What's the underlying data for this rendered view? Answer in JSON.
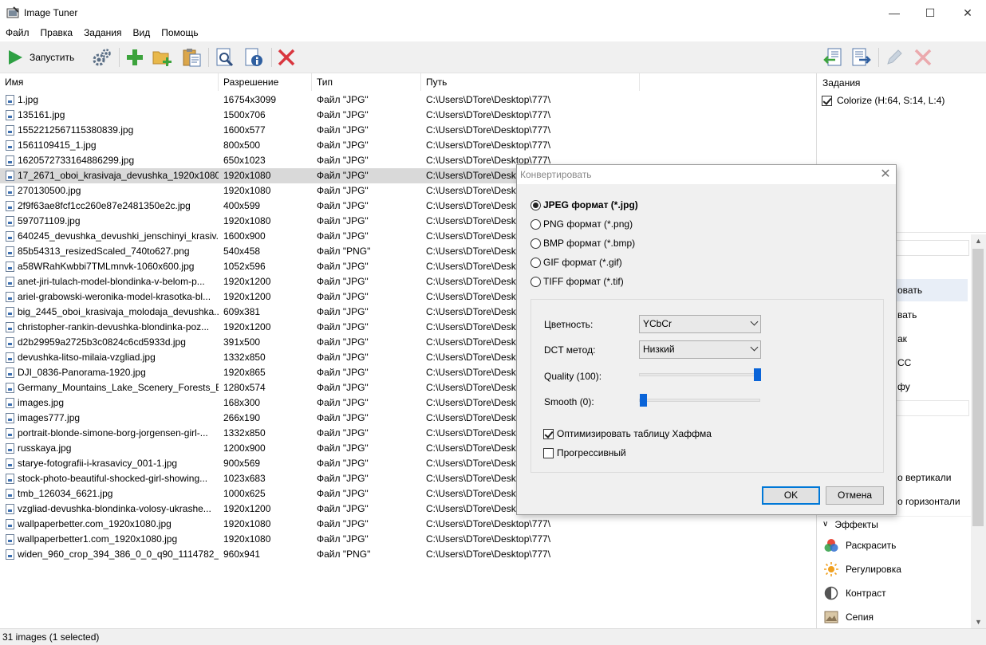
{
  "window": {
    "title": "Image Tuner",
    "minimize": "—",
    "maximize": "☐",
    "close": "✕"
  },
  "menu": [
    "Файл",
    "Правка",
    "Задания",
    "Вид",
    "Помощь"
  ],
  "toolbar": {
    "run_label": "Запустить"
  },
  "columns": {
    "name": "Имя",
    "resolution": "Разрешение",
    "type": "Тип",
    "path": "Путь"
  },
  "files": [
    {
      "name": "1.jpg",
      "res": "16754x3099",
      "type": "Файл \"JPG\"",
      "path": "C:\\Users\\DTore\\Desktop\\777\\"
    },
    {
      "name": "135161.jpg",
      "res": "1500x706",
      "type": "Файл \"JPG\"",
      "path": "C:\\Users\\DTore\\Desktop\\777\\"
    },
    {
      "name": "1552212567115380839.jpg",
      "res": "1600x577",
      "type": "Файл \"JPG\"",
      "path": "C:\\Users\\DTore\\Desktop\\777\\"
    },
    {
      "name": "1561109415_1.jpg",
      "res": "800x500",
      "type": "Файл \"JPG\"",
      "path": "C:\\Users\\DTore\\Desktop\\777\\"
    },
    {
      "name": "1620572733164886299.jpg",
      "res": "650x1023",
      "type": "Файл \"JPG\"",
      "path": "C:\\Users\\DTore\\Desktop\\777\\"
    },
    {
      "name": "17_2671_oboi_krasivaja_devushka_1920x1080....",
      "res": "1920x1080",
      "type": "Файл \"JPG\"",
      "path": "C:\\Users\\DTore\\Deskto"
    },
    {
      "name": "270130500.jpg",
      "res": "1920x1080",
      "type": "Файл \"JPG\"",
      "path": "C:\\Users\\DTore\\Deskto"
    },
    {
      "name": "2f9f63ae8fcf1cc260e87e2481350e2c.jpg",
      "res": "400x599",
      "type": "Файл \"JPG\"",
      "path": "C:\\Users\\DTore\\Deskto"
    },
    {
      "name": "597071109.jpg",
      "res": "1920x1080",
      "type": "Файл \"JPG\"",
      "path": "C:\\Users\\DTore\\Deskto"
    },
    {
      "name": "640245_devushka_devushki_jenschinyi_krasiv...",
      "res": "1600x900",
      "type": "Файл \"JPG\"",
      "path": "C:\\Users\\DTore\\Deskto"
    },
    {
      "name": "85b54313_resizedScaled_740to627.png",
      "res": "540x458",
      "type": "Файл \"PNG\"",
      "path": "C:\\Users\\DTore\\Deskto"
    },
    {
      "name": "a58WRahKwbbi7TMLmnvk-1060x600.jpg",
      "res": "1052x596",
      "type": "Файл \"JPG\"",
      "path": "C:\\Users\\DTore\\Deskto"
    },
    {
      "name": "anet-jiri-tulach-model-blondinka-v-belom-p...",
      "res": "1920x1200",
      "type": "Файл \"JPG\"",
      "path": "C:\\Users\\DTore\\Deskto"
    },
    {
      "name": "ariel-grabowski-weronika-model-krasotka-bl...",
      "res": "1920x1200",
      "type": "Файл \"JPG\"",
      "path": "C:\\Users\\DTore\\Deskto"
    },
    {
      "name": "big_2445_oboi_krasivaja_molodaja_devushka...",
      "res": "609x381",
      "type": "Файл \"JPG\"",
      "path": "C:\\Users\\DTore\\Deskto"
    },
    {
      "name": "christopher-rankin-devushka-blondinka-poz...",
      "res": "1920x1200",
      "type": "Файл \"JPG\"",
      "path": "C:\\Users\\DTore\\Deskto"
    },
    {
      "name": "d2b29959a2725b3c0824c6cd5933d.jpg",
      "res": "391x500",
      "type": "Файл \"JPG\"",
      "path": "C:\\Users\\DTore\\Deskto"
    },
    {
      "name": "devushka-litso-milaia-vzgliad.jpg",
      "res": "1332x850",
      "type": "Файл \"JPG\"",
      "path": "C:\\Users\\DTore\\Deskto"
    },
    {
      "name": "DJI_0836-Panorama-1920.jpg",
      "res": "1920x865",
      "type": "Файл \"JPG\"",
      "path": "C:\\Users\\DTore\\Deskto"
    },
    {
      "name": "Germany_Mountains_Lake_Scenery_Forests_B...",
      "res": "1280x574",
      "type": "Файл \"JPG\"",
      "path": "C:\\Users\\DTore\\Deskto"
    },
    {
      "name": "images.jpg",
      "res": "168x300",
      "type": "Файл \"JPG\"",
      "path": "C:\\Users\\DTore\\Deskto"
    },
    {
      "name": "images777.jpg",
      "res": "266x190",
      "type": "Файл \"JPG\"",
      "path": "C:\\Users\\DTore\\Deskto"
    },
    {
      "name": "portrait-blonde-simone-borg-jorgensen-girl-...",
      "res": "1332x850",
      "type": "Файл \"JPG\"",
      "path": "C:\\Users\\DTore\\Deskto"
    },
    {
      "name": "russkaya.jpg",
      "res": "1200x900",
      "type": "Файл \"JPG\"",
      "path": "C:\\Users\\DTore\\Deskto"
    },
    {
      "name": "starye-fotografii-i-krasavicy_001-1.jpg",
      "res": "900x569",
      "type": "Файл \"JPG\"",
      "path": "C:\\Users\\DTore\\Deskto"
    },
    {
      "name": "stock-photo-beautiful-shocked-girl-showing...",
      "res": "1023x683",
      "type": "Файл \"JPG\"",
      "path": "C:\\Users\\DTore\\Deskto"
    },
    {
      "name": "tmb_126034_6621.jpg",
      "res": "1000x625",
      "type": "Файл \"JPG\"",
      "path": "C:\\Users\\DTore\\Deskto"
    },
    {
      "name": "vzgliad-devushka-blondinka-volosy-ukrashe...",
      "res": "1920x1200",
      "type": "Файл \"JPG\"",
      "path": "C:\\Users\\DTore\\Deskto"
    },
    {
      "name": "wallpaperbetter.com_1920x1080.jpg",
      "res": "1920x1080",
      "type": "Файл \"JPG\"",
      "path": "C:\\Users\\DTore\\Desktop\\777\\"
    },
    {
      "name": "wallpaperbetter1.com_1920x1080.jpg",
      "res": "1920x1080",
      "type": "Файл \"JPG\"",
      "path": "C:\\Users\\DTore\\Desktop\\777\\"
    },
    {
      "name": "widen_960_crop_394_386_0_0_q90_1114782_d...",
      "res": "960x941",
      "type": "Файл \"PNG\"",
      "path": "C:\\Users\\DTore\\Desktop\\777\\"
    }
  ],
  "selected_index": 5,
  "status": {
    "text": "31 images (1 selected)"
  },
  "tasks": {
    "header": "Задания",
    "items": [
      {
        "label": "Colorize (H:64, S:14, L:4)",
        "checked": true
      }
    ]
  },
  "right_list": {
    "partial_items": [
      "овать",
      "вать",
      "ак",
      "СС",
      "фу",
      "о вертикали",
      "о горизонтали"
    ],
    "effects_header": "Эффекты",
    "effects": [
      {
        "label": "Раскрасить",
        "icon": "colorize-icon"
      },
      {
        "label": "Регулировка",
        "icon": "sun-icon"
      },
      {
        "label": "Контраст",
        "icon": "contrast-icon"
      },
      {
        "label": "Сепия",
        "icon": "sepia-icon"
      }
    ]
  },
  "dialog": {
    "title": "Конвертировать",
    "formats": [
      {
        "label": "JPEG формат (*.jpg)",
        "selected": true
      },
      {
        "label": "PNG формат (*.png)",
        "selected": false
      },
      {
        "label": "BMP формат (*.bmp)",
        "selected": false
      },
      {
        "label": "GIF формат (*.gif)",
        "selected": false
      },
      {
        "label": "TIFF формат (*.tif)",
        "selected": false
      }
    ],
    "color_label": "Цветность:",
    "color_value": "YCbCr",
    "dct_label": "DCT метод:",
    "dct_value": "Низкий",
    "quality_label": "Quality (100):",
    "quality_value": 100,
    "smooth_label": "Smooth (0):",
    "smooth_value": 0,
    "optimize_label": "Оптимизировать таблицу Хаффмана",
    "optimize_checked": true,
    "progressive_label": "Прогрессивный",
    "progressive_checked": false,
    "ok_label": "OK",
    "cancel_label": "Отмена"
  },
  "colors": {
    "accent": "#0078d7",
    "run_green": "#2ea043",
    "delete_red": "#d9363e",
    "slider_blue": "#0a64d8",
    "selection": "#d9d9d9"
  }
}
